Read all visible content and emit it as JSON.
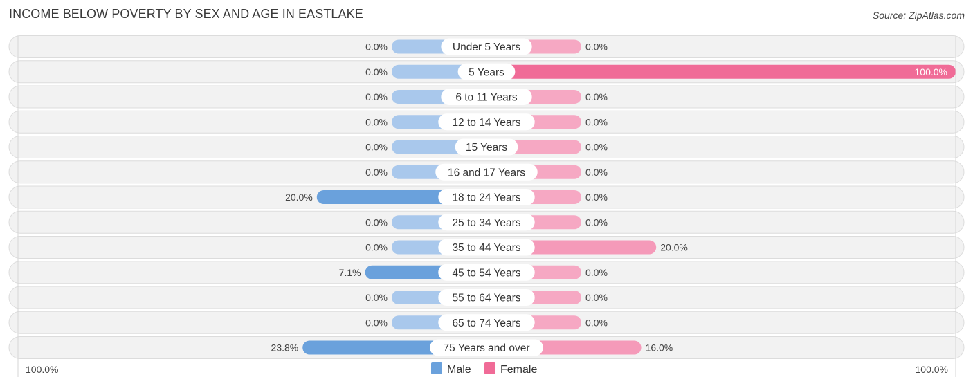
{
  "header": {
    "title": "INCOME BELOW POVERTY BY SEX AND AGE IN EASTLAKE",
    "source": "Source: ZipAtlas.com"
  },
  "colors": {
    "male_light": "#a9c8ec",
    "male_dark": "#6aa1dc",
    "female_light": "#f6a8c3",
    "female_dark": "#f06b97",
    "row_bg": "#f2f2f2"
  },
  "chart_data": {
    "type": "bar",
    "orientation": "horizontal-diverging",
    "title": "INCOME BELOW POVERTY BY SEX AND AGE IN EASTLAKE",
    "categories": [
      "Under 5 Years",
      "5 Years",
      "6 to 11 Years",
      "12 to 14 Years",
      "15 Years",
      "16 and 17 Years",
      "18 to 24 Years",
      "25 to 34 Years",
      "35 to 44 Years",
      "45 to 54 Years",
      "55 to 64 Years",
      "65 to 74 Years",
      "75 Years and over"
    ],
    "series": [
      {
        "name": "Male",
        "side": "left",
        "values": [
          0.0,
          0.0,
          0.0,
          0.0,
          0.0,
          0.0,
          20.0,
          0.0,
          0.0,
          7.1,
          0.0,
          0.0,
          23.8
        ],
        "labels": [
          "0.0%",
          "0.0%",
          "0.0%",
          "0.0%",
          "0.0%",
          "0.0%",
          "20.0%",
          "0.0%",
          "0.0%",
          "7.1%",
          "0.0%",
          "0.0%",
          "23.8%"
        ]
      },
      {
        "name": "Female",
        "side": "right",
        "values": [
          0.0,
          100.0,
          0.0,
          0.0,
          0.0,
          0.0,
          0.0,
          0.0,
          20.0,
          0.0,
          0.0,
          0.0,
          16.0
        ],
        "labels": [
          "0.0%",
          "100.0%",
          "0.0%",
          "0.0%",
          "0.0%",
          "0.0%",
          "0.0%",
          "0.0%",
          "20.0%",
          "0.0%",
          "0.0%",
          "0.0%",
          "16.0%"
        ]
      }
    ],
    "xlim": [
      0,
      100
    ],
    "axis_labels": {
      "left": "100.0%",
      "right": "100.0%"
    },
    "legend": {
      "position": "bottom-center",
      "entries": [
        "Male",
        "Female"
      ]
    },
    "grid": false
  }
}
